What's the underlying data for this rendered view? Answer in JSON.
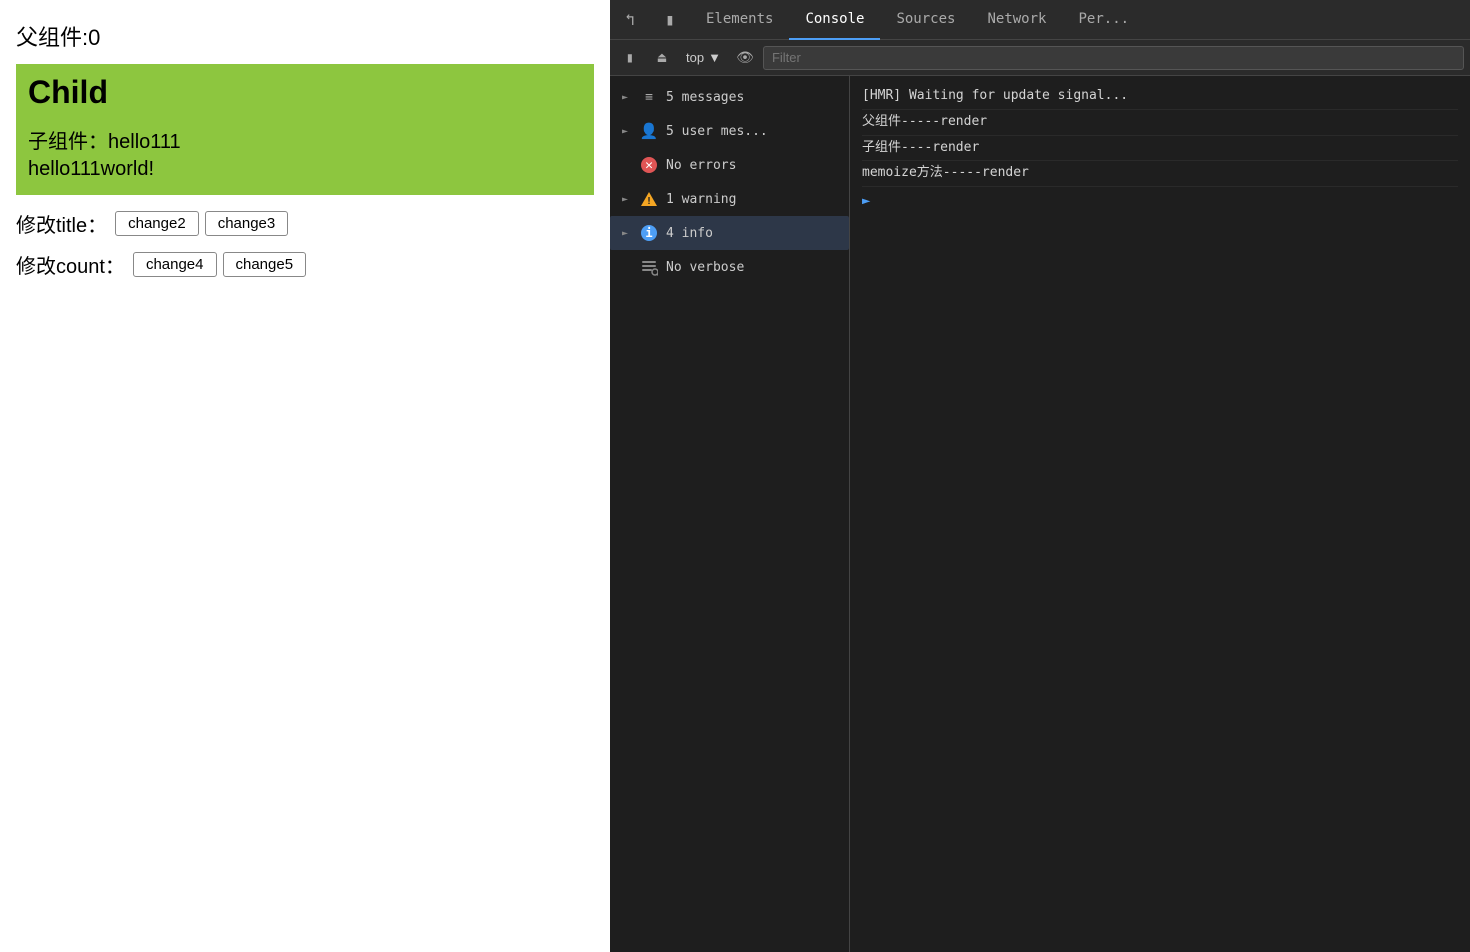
{
  "left": {
    "parent_label": "父组件:0",
    "child_title": "Child",
    "child_sub": "子组件：hello111",
    "child_world": "hello111world!",
    "modify_title_label": "修改title：",
    "modify_count_label": "修改count：",
    "btn_change2": "change2",
    "btn_change3": "change3",
    "btn_change4": "change4",
    "btn_change5": "change5"
  },
  "devtools": {
    "tabs": {
      "elements": "Elements",
      "console": "Console",
      "sources": "Sources",
      "network": "Network",
      "performance": "Per..."
    },
    "toolbar": {
      "top_label": "top",
      "filter_placeholder": "Filter"
    },
    "log_levels": [
      {
        "id": "messages",
        "label": "5 messages",
        "icon": "list",
        "has_arrow": true
      },
      {
        "id": "user",
        "label": "5 user mes...",
        "icon": "user",
        "has_arrow": true
      },
      {
        "id": "errors",
        "label": "No errors",
        "icon": "error",
        "has_arrow": false
      },
      {
        "id": "warning",
        "label": "1 warning",
        "icon": "warning",
        "has_arrow": true
      },
      {
        "id": "info",
        "label": "4 info",
        "icon": "info",
        "has_arrow": true,
        "active": true
      },
      {
        "id": "verbose",
        "label": "No verbose",
        "icon": "verbose",
        "has_arrow": false
      }
    ],
    "console_lines": [
      "[HMR] Waiting for update signal...",
      "父组件-----render",
      "子组件----render",
      "memoize方法-----render"
    ]
  }
}
